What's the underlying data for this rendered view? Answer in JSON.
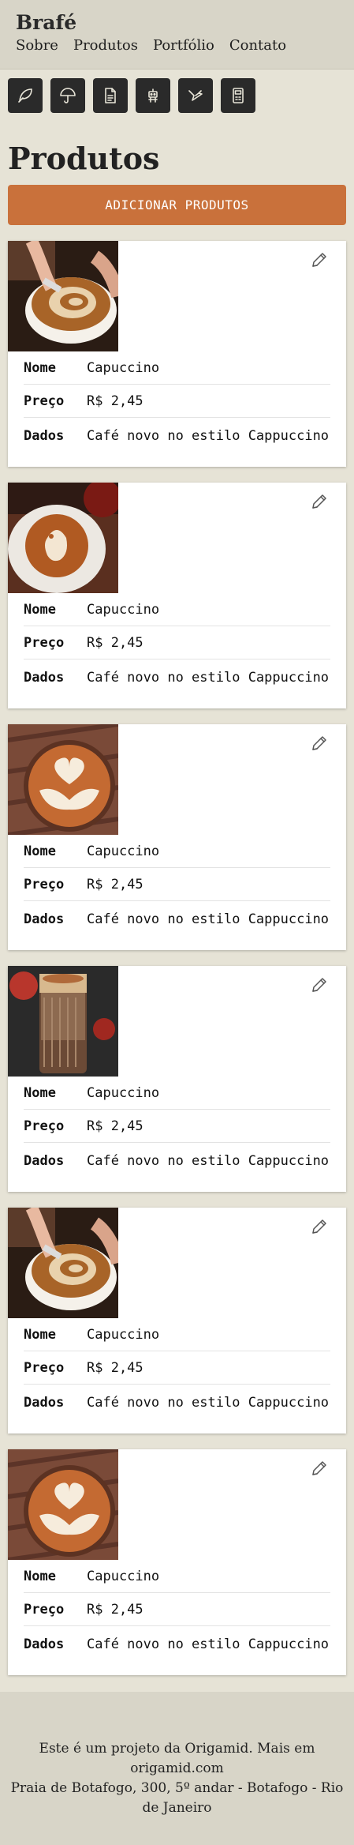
{
  "header": {
    "brand": "Brafé",
    "nav": [
      "Sobre",
      "Produtos",
      "Portfólio",
      "Contato"
    ]
  },
  "icons": [
    "feather-icon",
    "umbrella-icon",
    "document-icon",
    "robot-icon",
    "bird-icon",
    "calculator-icon"
  ],
  "page": {
    "title": "Produtos",
    "add_button": "ADICIONAR PRODUTOS"
  },
  "labels": {
    "nome": "Nome",
    "preco": "Preço",
    "dados": "Dados"
  },
  "products": [
    {
      "nome": "Capuccino",
      "preco": "R$ 2,45",
      "dados": "Café novo no estilo Cappuccino",
      "image": "latte-art-pour"
    },
    {
      "nome": "Capuccino",
      "preco": "R$ 2,45",
      "dados": "Café novo no estilo Cappuccino",
      "image": "latte-art-ghost"
    },
    {
      "nome": "Capuccino",
      "preco": "R$ 2,45",
      "dados": "Café novo no estilo Cappuccino",
      "image": "latte-art-heart"
    },
    {
      "nome": "Capuccino",
      "preco": "R$ 2,45",
      "dados": "Café novo no estilo Cappuccino",
      "image": "iced-latte-glass"
    },
    {
      "nome": "Capuccino",
      "preco": "R$ 2,45",
      "dados": "Café novo no estilo Cappuccino",
      "image": "latte-art-pour"
    },
    {
      "nome": "Capuccino",
      "preco": "R$ 2,45",
      "dados": "Café novo no estilo Cappuccino",
      "image": "latte-art-heart"
    }
  ],
  "footer": {
    "line1": "Este é um projeto da Origamid. Mais em origamid.com",
    "line2": "Praia de Botafogo, 300, 5º andar - Botafogo - Rio de Janeiro"
  },
  "colors": {
    "background": "#e6e3d6",
    "header": "#d8d5c8",
    "accent": "#c9713b",
    "icon_bg": "#2a2a2a"
  }
}
